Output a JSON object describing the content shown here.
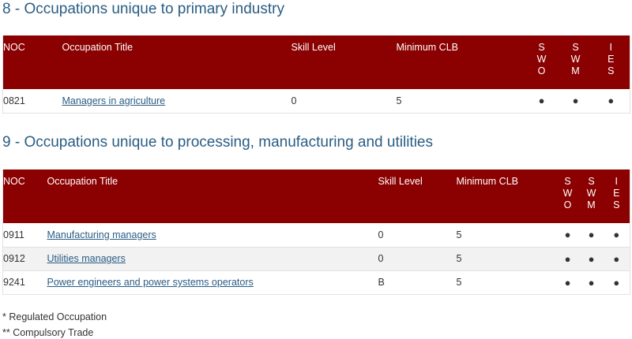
{
  "headers": {
    "noc": "NOC",
    "title": "Occupation Title",
    "skill": "Skill Level",
    "clb": "Minimum CLB",
    "swo": [
      "S",
      "W",
      "O"
    ],
    "swm": [
      "S",
      "W",
      "M"
    ],
    "ies": [
      "I",
      "E",
      "S"
    ]
  },
  "sections": [
    {
      "heading": "8 - Occupations unique to primary industry",
      "rows": [
        {
          "noc": "0821",
          "title": "Managers in agriculture",
          "skill": "0",
          "clb": "5",
          "swo": "●",
          "swm": "●",
          "ies": "●"
        }
      ]
    },
    {
      "heading": "9 - Occupations unique to processing, manufacturing and utilities",
      "rows": [
        {
          "noc": "0911",
          "title": "Manufacturing managers",
          "skill": "0",
          "clb": "5",
          "swo": "●",
          "swm": "●",
          "ies": "●"
        },
        {
          "noc": "0912",
          "title": "Utilities managers",
          "skill": "0",
          "clb": "5",
          "swo": "●",
          "swm": "●",
          "ies": "●"
        },
        {
          "noc": "9241",
          "title": "Power engineers and power systems operators",
          "skill": "B",
          "clb": "5",
          "swo": "●",
          "swm": "●",
          "ies": "●"
        }
      ]
    }
  ],
  "footnotes": [
    "* Regulated Occupation",
    "** Compulsory Trade"
  ],
  "colors": {
    "header_bg": "#8b0000",
    "heading": "#2a5d84",
    "link": "#2a5d84",
    "alt_row": "#f2f2f2"
  }
}
